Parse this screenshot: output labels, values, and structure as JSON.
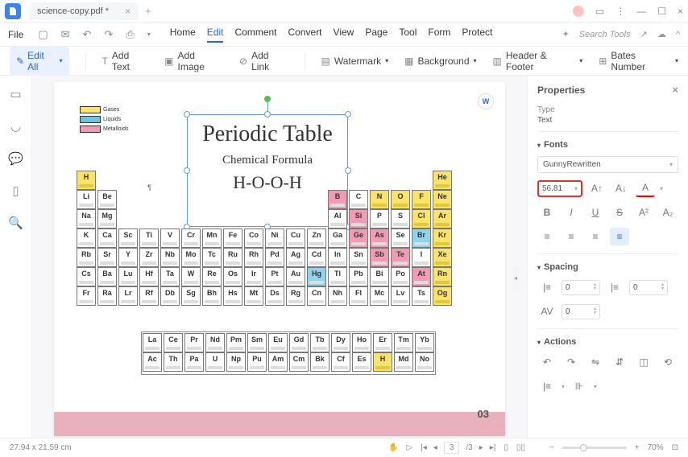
{
  "titlebar": {
    "tab_name": "science-copy.pdf *"
  },
  "menubar": {
    "file": "File",
    "tabs": [
      "Home",
      "Edit",
      "Comment",
      "Convert",
      "View",
      "Page",
      "Tool",
      "Form",
      "Protect"
    ],
    "active_tab": "Edit",
    "search_placeholder": "Search Tools"
  },
  "toolbar": {
    "edit_all": "Edit All",
    "add_text": "Add Text",
    "add_image": "Add Image",
    "add_link": "Add Link",
    "watermark": "Watermark",
    "background": "Background",
    "header_footer": "Header & Footer",
    "bates_number": "Bates Number"
  },
  "legend": {
    "gases": "Gases",
    "liquids": "Liquids",
    "metalloids": "Metalloids"
  },
  "document": {
    "title": "Periodic Table",
    "subtitle": "Chemical Formula",
    "formula": "H-O-O-H",
    "page_number": "03"
  },
  "elements": {
    "row1": [
      "H",
      "He"
    ],
    "row2": [
      "Li",
      "Be",
      "B",
      "C",
      "N",
      "O",
      "F",
      "Ne"
    ],
    "row3": [
      "Na",
      "Mg",
      "Al",
      "Si",
      "P",
      "S",
      "Cl",
      "Ar"
    ],
    "row4": [
      "K",
      "Ca",
      "Sc",
      "Ti",
      "V",
      "Cr",
      "Mn",
      "Fe",
      "Co",
      "Ni",
      "Cu",
      "Zn",
      "Ga",
      "Ge",
      "As",
      "Se",
      "Br",
      "Kr"
    ],
    "row5": [
      "Rb",
      "Sr",
      "Y",
      "Zr",
      "Nb",
      "Mo",
      "Tc",
      "Ru",
      "Rh",
      "Pd",
      "Ag",
      "Cd",
      "In",
      "Sn",
      "Sb",
      "Te",
      "I",
      "Xe"
    ],
    "row6": [
      "Cs",
      "Ba",
      "Lu",
      "Hf",
      "Ta",
      "W",
      "Re",
      "Os",
      "Ir",
      "Pt",
      "Au",
      "Hg",
      "Tl",
      "Pb",
      "Bi",
      "Po",
      "At",
      "Rn"
    ],
    "row7": [
      "Fr",
      "Ra",
      "Lr",
      "Rf",
      "Db",
      "Sg",
      "Bh",
      "Hs",
      "Mt",
      "Ds",
      "Rg",
      "Cn",
      "Nh",
      "Fl",
      "Mc",
      "Lv",
      "Ts",
      "Og"
    ],
    "la": [
      "La",
      "Ce",
      "Pr",
      "Nd",
      "Pm",
      "Sm",
      "Eu",
      "Gd",
      "Tb",
      "Dy",
      "Ho",
      "Er",
      "Tm",
      "Yb"
    ],
    "ac": [
      "Ac",
      "Th",
      "Pa",
      "U",
      "Np",
      "Pu",
      "Am",
      "Cm",
      "Bk",
      "Cf",
      "Es",
      "H",
      "Md",
      "No"
    ]
  },
  "properties": {
    "header": "Properties",
    "type_label": "Type",
    "type_value": "Text",
    "fonts_label": "Fonts",
    "font_family": "GunnyRewritten",
    "font_size": "56.81",
    "spacing_label": "Spacing",
    "spacing_values": {
      "line": "0",
      "para": "0",
      "char": "0"
    },
    "actions_label": "Actions"
  },
  "status": {
    "dimensions": "27.94 x 21.59 cm",
    "page_current": "3",
    "page_total": "/3",
    "zoom": "70%"
  }
}
